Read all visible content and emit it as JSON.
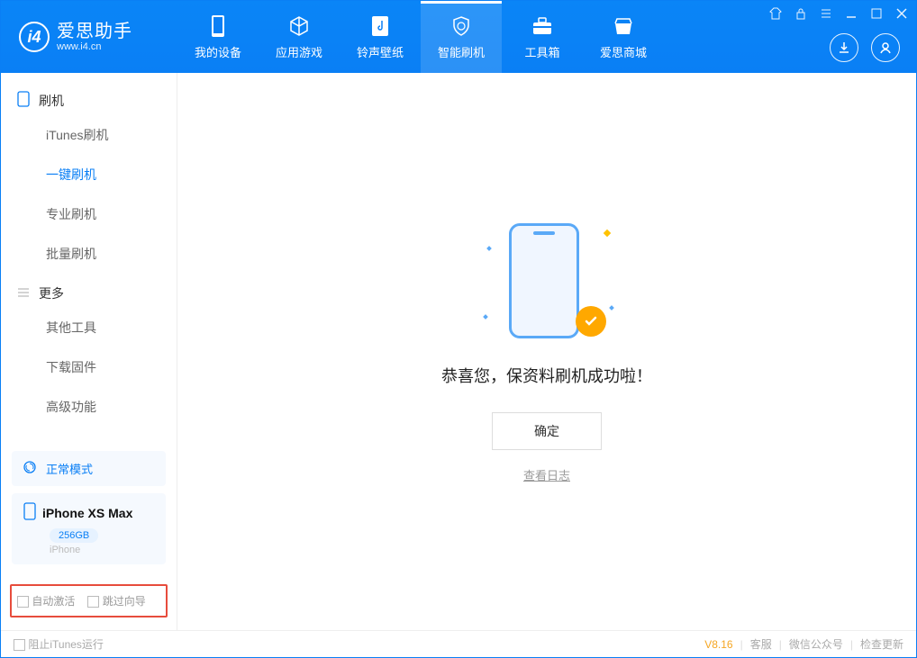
{
  "app": {
    "name_cn": "爱思助手",
    "name_en": "www.i4.cn"
  },
  "nav": {
    "items": [
      {
        "label": "我的设备"
      },
      {
        "label": "应用游戏"
      },
      {
        "label": "铃声壁纸"
      },
      {
        "label": "智能刷机"
      },
      {
        "label": "工具箱"
      },
      {
        "label": "爱思商城"
      }
    ]
  },
  "sidebar": {
    "group1": "刷机",
    "items1": [
      {
        "label": "iTunes刷机"
      },
      {
        "label": "一键刷机"
      },
      {
        "label": "专业刷机"
      },
      {
        "label": "批量刷机"
      }
    ],
    "group2": "更多",
    "items2": [
      {
        "label": "其他工具"
      },
      {
        "label": "下载固件"
      },
      {
        "label": "高级功能"
      }
    ]
  },
  "device": {
    "mode": "正常模式",
    "name": "iPhone XS Max",
    "storage": "256GB",
    "type": "iPhone"
  },
  "checks": {
    "auto_activate": "自动激活",
    "skip_guide": "跳过向导"
  },
  "main": {
    "success_text": "恭喜您，保资料刷机成功啦！",
    "ok_button": "确定",
    "view_log": "查看日志"
  },
  "status": {
    "block_itunes": "阻止iTunes运行",
    "version": "V8.16",
    "service": "客服",
    "wechat": "微信公众号",
    "check_update": "检查更新"
  }
}
